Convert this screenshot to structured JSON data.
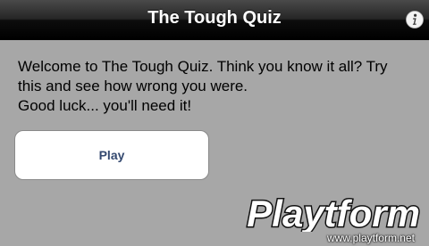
{
  "navbar": {
    "title": "The Tough Quiz",
    "info_icon": "info-icon"
  },
  "main": {
    "welcome_lines": [
      "Welcome to The Tough Quiz. Think you know it all? Try",
      "this and see how wrong you were.",
      "Good luck... you'll need it!"
    ],
    "play_label": "Play"
  },
  "watermark": {
    "logo_text": "Playtform",
    "url": "www.playtform.net"
  },
  "colors": {
    "background": "#a7a7a7",
    "button_text": "#33486f",
    "navbar": "#1a1a1a"
  }
}
